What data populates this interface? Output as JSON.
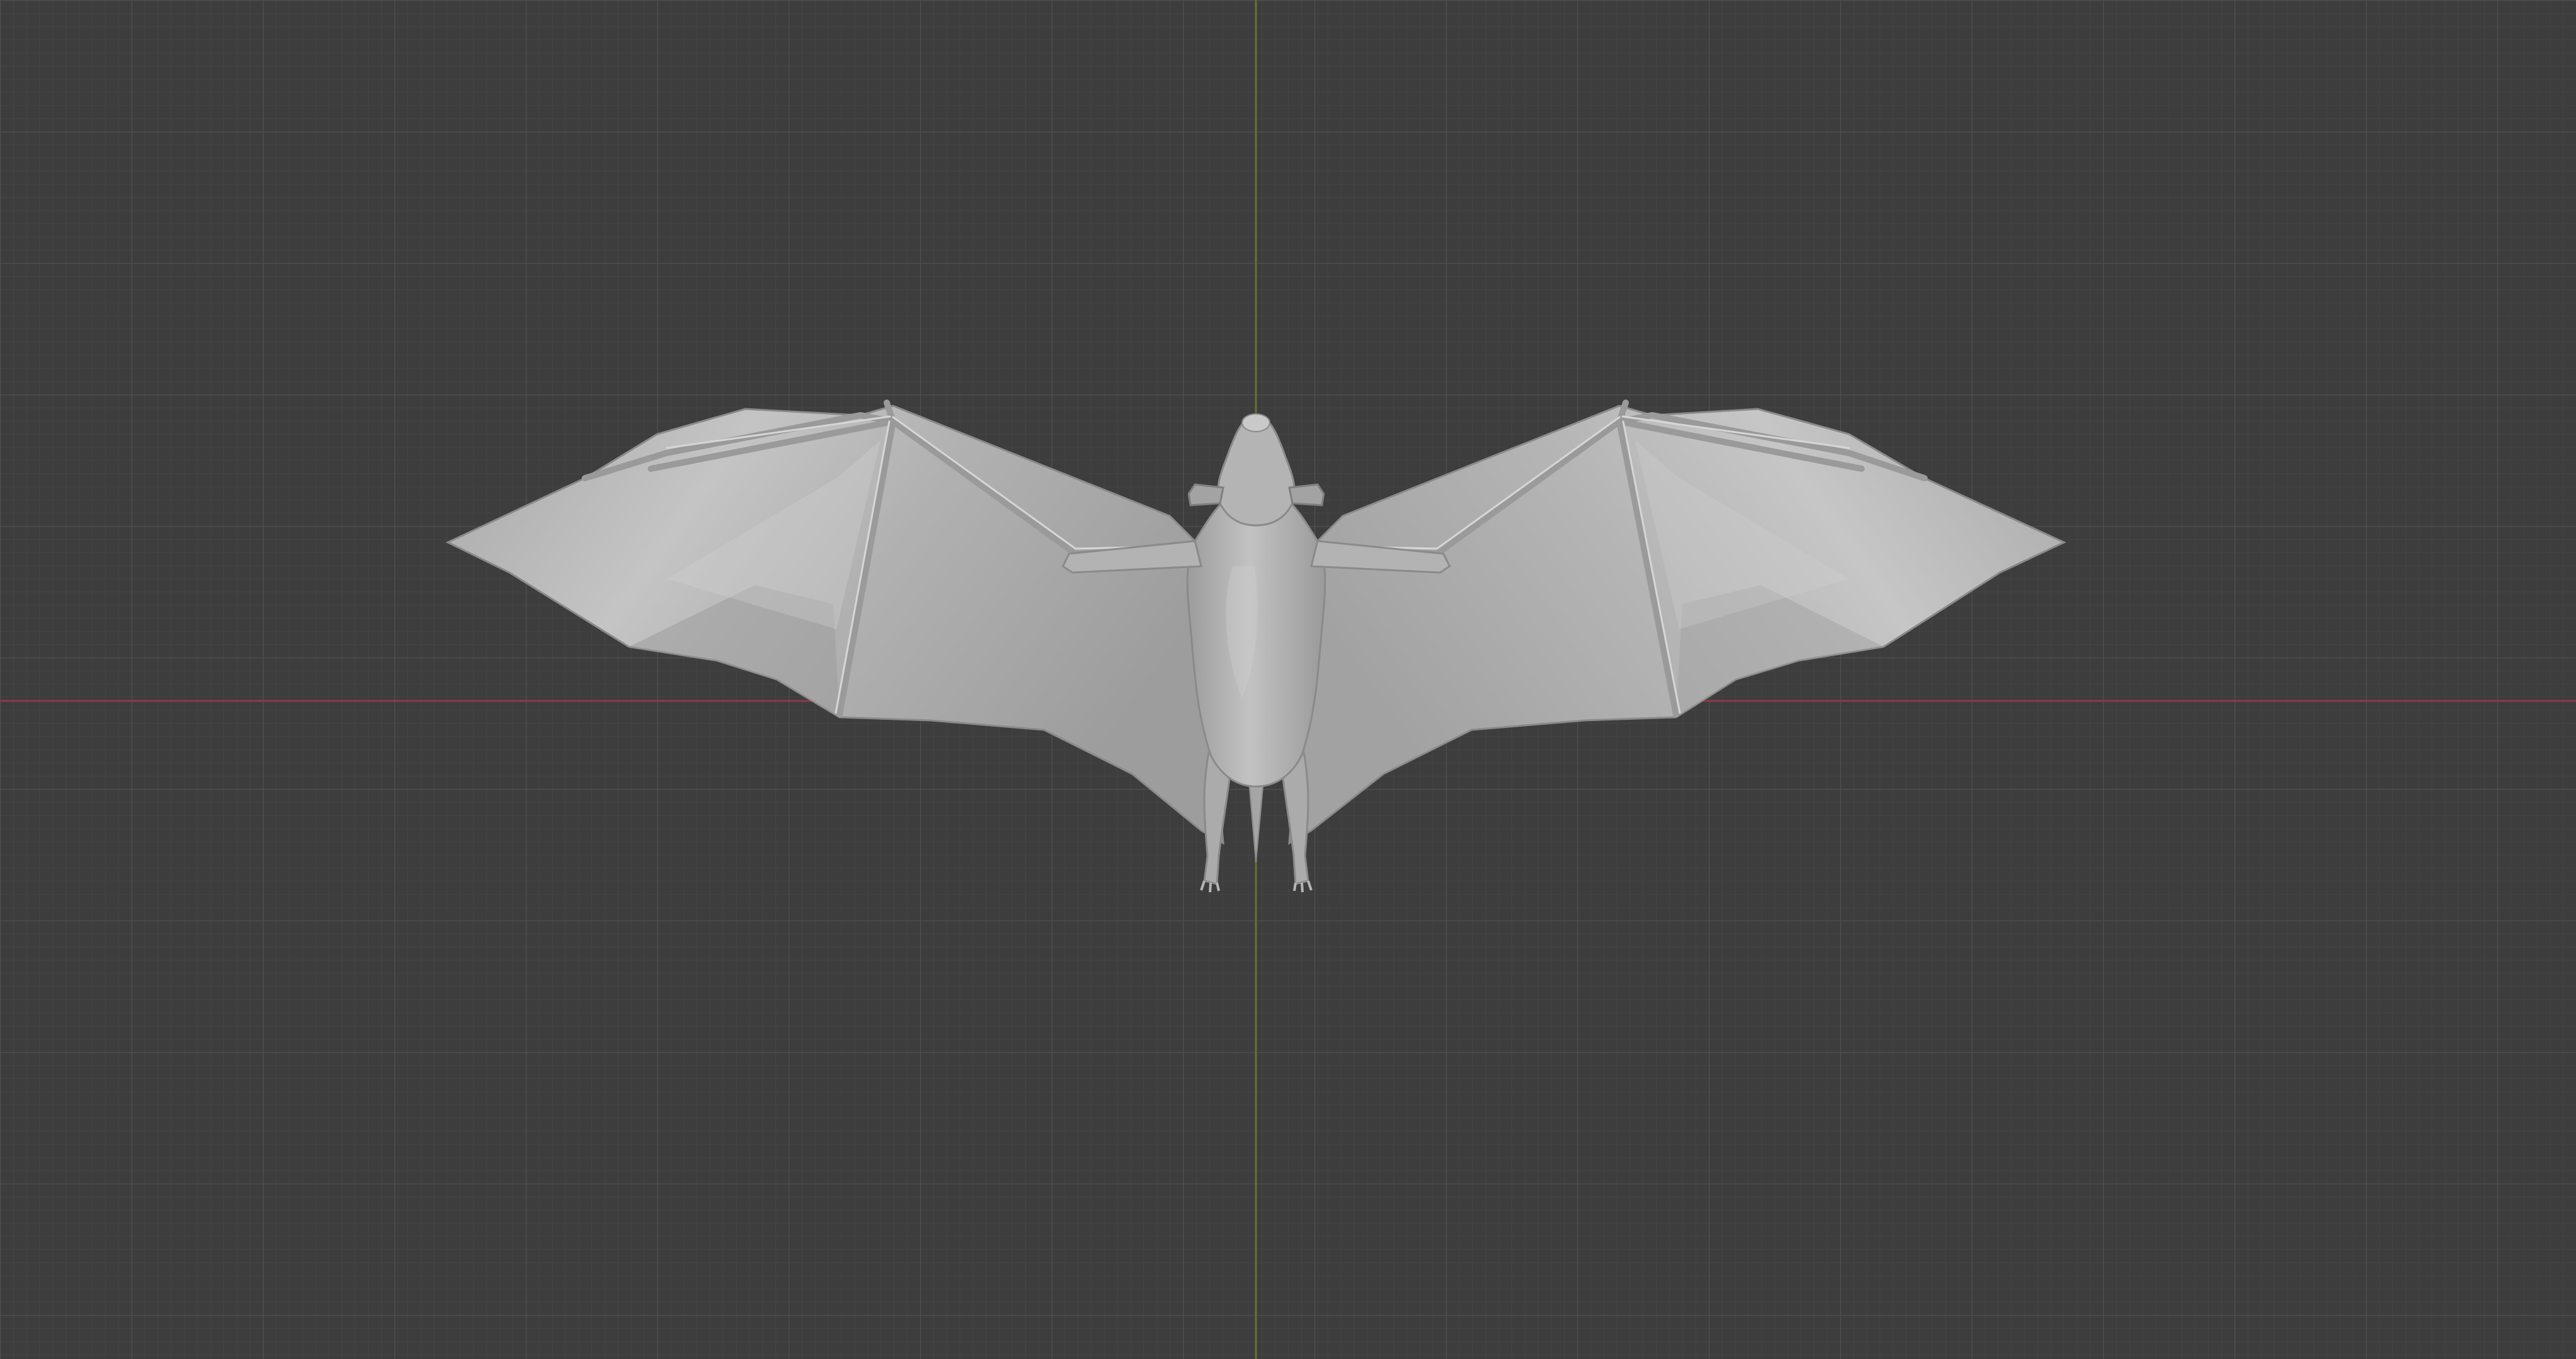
{
  "viewport": {
    "background_color": "#3d3d3d",
    "grid_minor_color": "#444444",
    "grid_major_color": "#4d4d4d",
    "x_axis_color": "#9a3d4a",
    "y_axis_color": "#6e7a2c"
  },
  "model": {
    "object": "bat",
    "pose": "wings-spread",
    "view": "top",
    "shading": "solid",
    "base_color": "#b8b8b8",
    "shadow_color": "#8f8f8f",
    "highlight_color": "#cfcfcf"
  }
}
